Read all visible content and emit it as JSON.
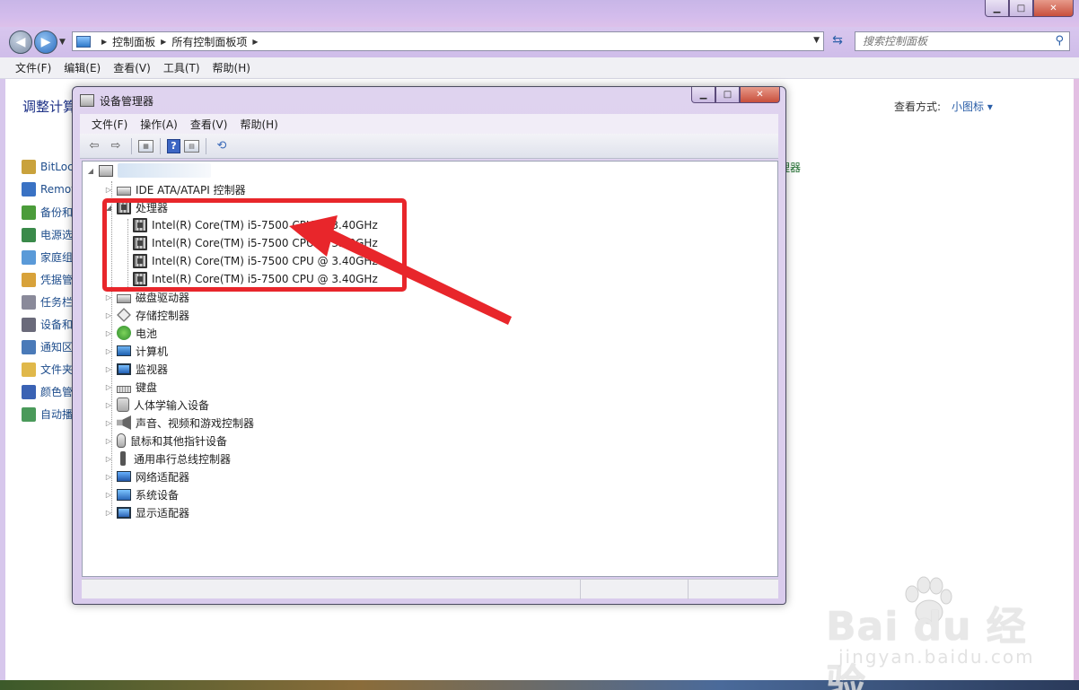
{
  "control_panel": {
    "breadcrumbs": [
      "控制面板",
      "所有控制面板项"
    ],
    "search_placeholder": "搜索控制面板",
    "menu": [
      "文件(F)",
      "编辑(E)",
      "查看(V)",
      "工具(T)",
      "帮助(H)"
    ],
    "heading": "调整计算",
    "view_label": "查看方式:",
    "view_value": "小图标 ▾",
    "left_items": [
      "BitLoc",
      "Remot",
      "备份和",
      "电源选",
      "家庭组",
      "凭据管",
      "任务栏",
      "设备和",
      "通知区",
      "文件夹",
      "颜色管",
      "自动播"
    ],
    "right_partial": "理器"
  },
  "device_manager": {
    "title": "设备管理器",
    "menu": [
      "文件(F)",
      "操作(A)",
      "查看(V)",
      "帮助(H)"
    ],
    "tree": {
      "ide": "IDE ATA/ATAPI 控制器",
      "processor": "处理器",
      "cpus": [
        "Intel(R) Core(TM) i5-7500 CPU @ 3.40GHz",
        "Intel(R) Core(TM) i5-7500 CPU @ 3.40GHz",
        "Intel(R) Core(TM) i5-7500 CPU @ 3.40GHz",
        "Intel(R) Core(TM) i5-7500 CPU @ 3.40GHz"
      ],
      "categories": [
        "磁盘驱动器",
        "存储控制器",
        "电池",
        "计算机",
        "监视器",
        "键盘",
        "人体学输入设备",
        "声音、视频和游戏控制器",
        "鼠标和其他指针设备",
        "通用串行总线控制器",
        "网络适配器",
        "系统设备",
        "显示适配器"
      ]
    }
  },
  "colors": {
    "highlight": "#e8262b",
    "link": "#1e4d8c"
  },
  "watermark": {
    "main": "Bai du 经验",
    "sub": "jingyan.baidu.com"
  }
}
